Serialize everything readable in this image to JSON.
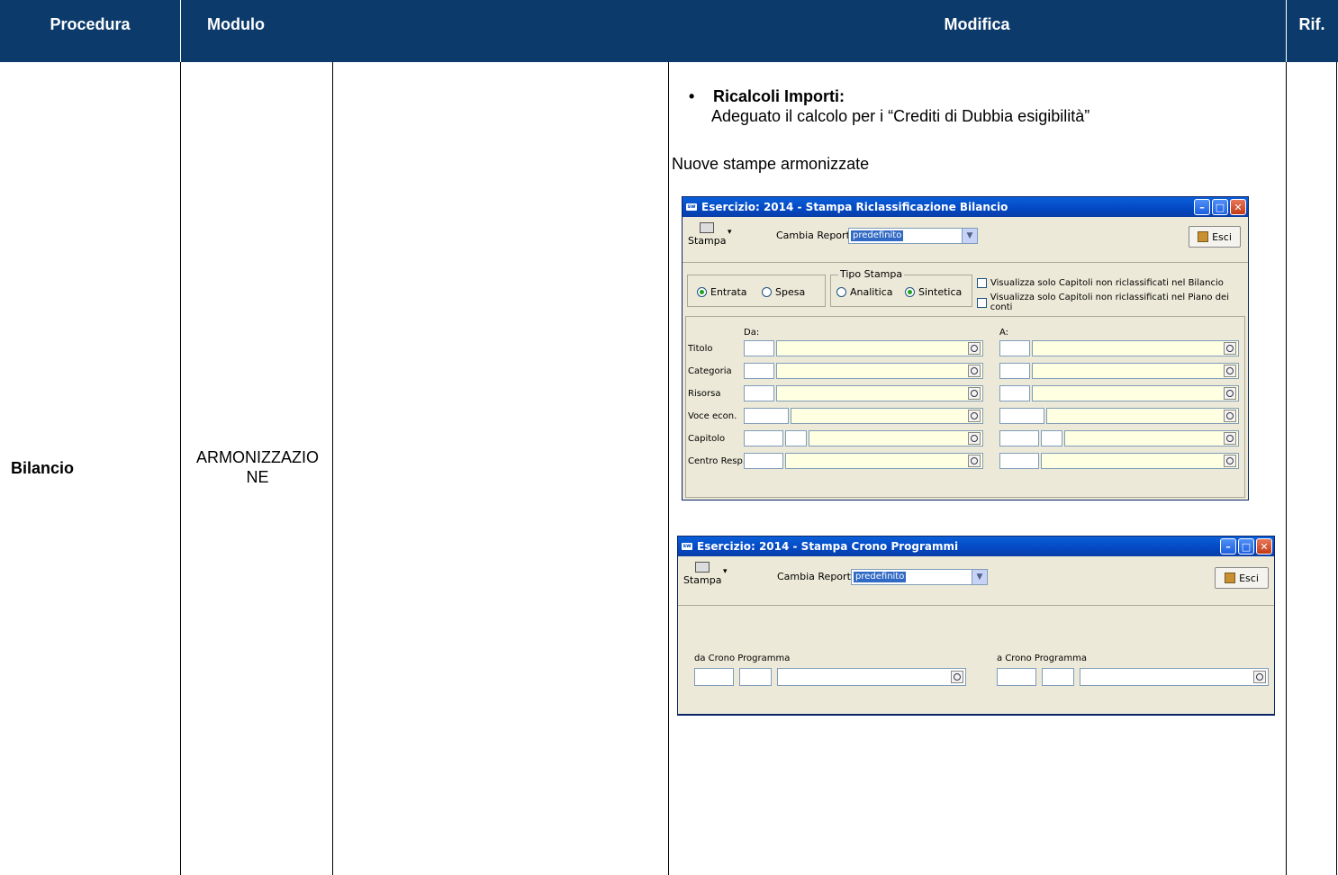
{
  "header": {
    "procedura": "Procedura",
    "modulo": "Modulo",
    "modifica": "Modifica",
    "rif": "Rif."
  },
  "row": {
    "procedura": "Bilancio",
    "modulo_line1": "ARMONIZZAZIO",
    "modulo_line2": "NE"
  },
  "content": {
    "bullet_title": "Ricalcoli Importi:",
    "bullet_text": "Adeguato il calcolo per i “Crediti di Dubbia esigibilità”",
    "section_title": "Nuove stampe armonizzate"
  },
  "win1": {
    "title": "Esercizio: 2014 - Stampa Riclassificazione Bilancio",
    "stampa": "Stampa",
    "cambia_report": "Cambia Report",
    "combo_value": "predefinito",
    "esci": "Esci",
    "radio_entrata": "Entrata",
    "radio_spesa": "Spesa",
    "tipo_stampa": "Tipo Stampa",
    "radio_analitica": "Analitica",
    "radio_sintetica": "Sintetica",
    "chk1": "Visualizza solo Capitoli non riclassificati nel Bilancio",
    "chk2": "Visualizza solo Capitoli non riclassificati nel Piano dei conti",
    "da": "Da:",
    "a": "A:",
    "rows": [
      "Titolo",
      "Categoria",
      "Risorsa",
      "Voce econ.",
      "Capitolo",
      "Centro Resp."
    ]
  },
  "win2": {
    "title": "Esercizio: 2014 - Stampa Crono Programmi",
    "stampa": "Stampa",
    "cambia_report": "Cambia Report",
    "combo_value": "predefinito",
    "esci": "Esci",
    "da_crono": "da Crono Programma",
    "a_crono": "a Crono Programma"
  }
}
